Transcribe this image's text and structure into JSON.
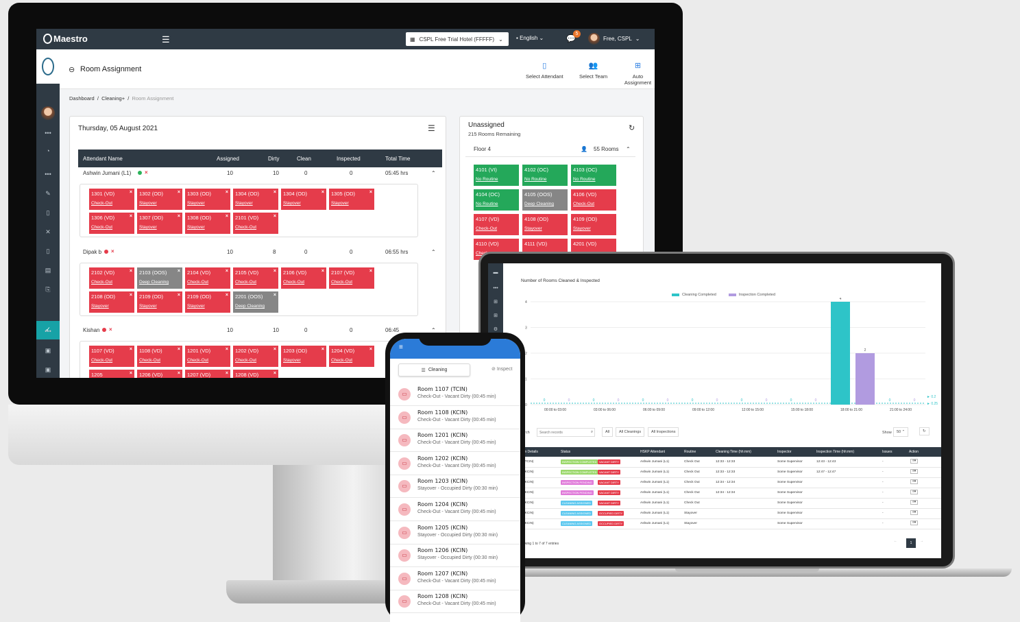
{
  "app": {
    "logo": "Maestro",
    "hotel": "CSPL Free Trial Hotel (FFFFF)",
    "language": "English",
    "notifications": "5",
    "user": "Free, CSPL",
    "page_title": "Room Assignment",
    "actions": [
      "Select Attendant",
      "Select Team",
      "Auto Assignment"
    ],
    "breadcrumb": [
      "Dashboard",
      "Cleaning+",
      "Room Assignment"
    ],
    "date": "Thursday, 05 August 2021"
  },
  "table": {
    "headers": [
      "Attendant Name",
      "Assigned",
      "Dirty",
      "Clean",
      "Inspected",
      "Total Time"
    ],
    "attendants": [
      {
        "name": "Ashwin Jumani (L1)",
        "status": "#2bb25a",
        "assigned": "10",
        "dirty": "10",
        "clean": "0",
        "inspected": "0",
        "time": "05:45 hrs",
        "rooms": [
          {
            "room": "1301 (VD)",
            "type": "Check-Out",
            "color": "red"
          },
          {
            "room": "1302 (OD)",
            "type": "Stayover",
            "color": "red"
          },
          {
            "room": "1303 (OD)",
            "type": "Stayover",
            "color": "red"
          },
          {
            "room": "1304 (OD)",
            "type": "Stayover",
            "color": "red"
          },
          {
            "room": "1304 (OD)",
            "type": "Stayover",
            "color": "red"
          },
          {
            "room": "1305 (OD)",
            "type": "Stayover",
            "color": "red"
          },
          {
            "room": "1306 (VD)",
            "type": "Check-Out",
            "color": "red"
          },
          {
            "room": "1307 (OD)",
            "type": "Stayover",
            "color": "red"
          },
          {
            "room": "1308 (OD)",
            "type": "Stayover",
            "color": "red"
          },
          {
            "room": "2101 (VD)",
            "type": "Check-Out",
            "color": "red"
          }
        ]
      },
      {
        "name": "Dipak b",
        "status": "#e53c4b",
        "assigned": "10",
        "dirty": "8",
        "clean": "0",
        "inspected": "0",
        "time": "06:55 hrs",
        "rooms": [
          {
            "room": "2102 (VD)",
            "type": "Check-Out",
            "color": "red"
          },
          {
            "room": "2103 (OOS)",
            "type": "Deep Cleaning",
            "color": "grey"
          },
          {
            "room": "2104 (VD)",
            "type": "Check-Out",
            "color": "red"
          },
          {
            "room": "2105 (VD)",
            "type": "Check-Out",
            "color": "red"
          },
          {
            "room": "2106 (VD)",
            "type": "Check-Out",
            "color": "red"
          },
          {
            "room": "2107 (VD)",
            "type": "Check-Out",
            "color": "red"
          },
          {
            "room": "2108 (OD)",
            "type": "Stayover",
            "color": "red"
          },
          {
            "room": "2109 (OD)",
            "type": "Stayover",
            "color": "red"
          },
          {
            "room": "2109 (OD)",
            "type": "Stayover",
            "color": "red"
          },
          {
            "room": "2201 (OOS)",
            "type": "Deep Cleaning",
            "color": "grey"
          }
        ]
      },
      {
        "name": "Kishan",
        "status": "#e53c4b",
        "assigned": "10",
        "dirty": "10",
        "clean": "0",
        "inspected": "0",
        "time": "06:45",
        "rooms": [
          {
            "room": "1107 (VD)",
            "type": "Check-Out",
            "color": "red"
          },
          {
            "room": "1108 (VD)",
            "type": "Check-Out",
            "color": "red"
          },
          {
            "room": "1201 (VD)",
            "type": "Check-Out",
            "color": "red"
          },
          {
            "room": "1202 (VD)",
            "type": "Check-Out",
            "color": "red"
          },
          {
            "room": "1203 (OD)",
            "type": "Stayover",
            "color": "red"
          },
          {
            "room": "1204 (VD)",
            "type": "Check-Out",
            "color": "red"
          },
          {
            "room": "1205",
            "type": "Stay",
            "color": "red"
          },
          {
            "room": "1206 (VD)",
            "type": "",
            "color": "red"
          },
          {
            "room": "1207 (VD)",
            "type": "",
            "color": "red"
          },
          {
            "room": "1208 (VD)",
            "type": "",
            "color": "red"
          }
        ]
      }
    ]
  },
  "unassigned": {
    "title": "Unassigned",
    "remaining": "215 Rooms Remaining",
    "floor": "Floor 4",
    "floor_rooms": "55 Rooms",
    "rooms": [
      {
        "room": "4101 (VI)",
        "type": "No Routine",
        "color": "green"
      },
      {
        "room": "4102 (OC)",
        "type": "No Routine",
        "color": "green"
      },
      {
        "room": "4103 (OC)",
        "type": "No Routine",
        "color": "green"
      },
      {
        "room": "4104 (OC)",
        "type": "No Routine",
        "color": "green"
      },
      {
        "room": "4105 (OOS)",
        "type": "Deep Cleaning",
        "color": "grey"
      },
      {
        "room": "4106 (VD)",
        "type": "Check-Out",
        "color": "red"
      },
      {
        "room": "4107 (VD)",
        "type": "Check-Out",
        "color": "red"
      },
      {
        "room": "4108 (OD)",
        "type": "Stayover",
        "color": "red"
      },
      {
        "room": "4109 (OD)",
        "type": "Stayover",
        "color": "red"
      },
      {
        "room": "4110 (VD)",
        "type": "Check",
        "color": "red"
      },
      {
        "room": "4111 (VD)",
        "type": "",
        "color": "red"
      },
      {
        "room": "4201 (VD)",
        "type": "",
        "color": "red"
      }
    ]
  },
  "chart_data": {
    "type": "bar",
    "title": "Number of Rooms Cleaned & Inspected",
    "categories": [
      "00:00 to 03:00",
      "03:00 to 06:00",
      "06:00 to 09:00",
      "09:00 to 12:00",
      "12:00 to 15:00",
      "15:00 to 18:00",
      "18:00 to 21:00",
      "21:00 to 24:00"
    ],
    "series": [
      {
        "name": "Cleaning Completed",
        "color": "#2ec4c8",
        "values": [
          0,
          0,
          0,
          0,
          0,
          0,
          4,
          0
        ]
      },
      {
        "name": "Inspection Completed",
        "color": "#b19be0",
        "values": [
          0,
          0,
          0,
          0,
          0,
          0,
          2,
          0
        ]
      }
    ],
    "ylim": [
      0,
      4
    ],
    "yticks": [
      "0",
      "1",
      "2",
      "3",
      "4"
    ],
    "reference_labels": [
      "0.2",
      "0.25"
    ]
  },
  "report": {
    "search_label": "rch",
    "search_placeholder": "Search records",
    "filters": [
      "All",
      "All Cleanings",
      "All Inspections"
    ],
    "show_label": "Show",
    "show_value": "50",
    "headers": [
      "m Details",
      "Status",
      "HSKP Attendant",
      "Routine",
      "Cleaning Time (hh:mm)",
      "Inspector",
      "Inspection Time (hh:mm)",
      "Issues",
      "Action"
    ],
    "rows": [
      {
        "room": "(TCIN)",
        "s1": "INSPECTION COMPLETED",
        "c1": "#9bd86b",
        "s2": "VACANT DIRTY",
        "c2": "#e53c4b",
        "att": "Ashwin Jumani (L1)",
        "routine": "Check Out",
        "ctime": "12:33 - 12:33",
        "insp": "Some Supervisor",
        "itime": "12:43 - 12:43",
        "issues": "-"
      },
      {
        "room": "(KCIN)",
        "s1": "INSPECTION COMPLETED",
        "c1": "#9bd86b",
        "s2": "VACANT DIRTY",
        "c2": "#e53c4b",
        "att": "Ashwin Jumani (L1)",
        "routine": "Check Out",
        "ctime": "12:33 - 12:33",
        "insp": "Some Supervisor",
        "itime": "12:47 - 12:47",
        "issues": "-"
      },
      {
        "room": "(KCIN)",
        "s1": "INSPECTION PENDING",
        "c1": "#e07ad9",
        "s2": "VACANT DIRTY",
        "c2": "#e53c4b",
        "att": "Ashwin Jumani (L1)",
        "routine": "Check Out",
        "ctime": "12:34 - 12:34",
        "insp": "Some Supervisor",
        "itime": "",
        "issues": "-"
      },
      {
        "room": "(KCIN)",
        "s1": "INSPECTION PENDING",
        "c1": "#e07ad9",
        "s2": "VACANT DIRTY",
        "c2": "#e53c4b",
        "att": "Ashwin Jumani (L1)",
        "routine": "Check Out",
        "ctime": "12:34 - 12:34",
        "insp": "Some Supervisor",
        "itime": "",
        "issues": "-"
      },
      {
        "room": "(KCIN)",
        "s1": "CLEANING ASSIGNED",
        "c1": "#5ec8ef",
        "s2": "VACANT DIRTY",
        "c2": "#e53c4b",
        "att": "Ashwin Jumani (L1)",
        "routine": "Check Out",
        "ctime": "",
        "insp": "Some Supervisor",
        "itime": "",
        "issues": "-"
      },
      {
        "room": "(KCIN)",
        "s1": "CLEANING ASSIGNED",
        "c1": "#5ec8ef",
        "s2": "OCCUPIED DIRTY",
        "c2": "#e53c4b",
        "att": "Ashwin Jumani (L1)",
        "routine": "Stayover",
        "ctime": "",
        "insp": "Some Supervisor",
        "itime": "",
        "issues": "-"
      },
      {
        "room": "(KCIN)",
        "s1": "CLEANING ASSIGNED",
        "c1": "#5ec8ef",
        "s2": "OCCUPIED DIRTY",
        "c2": "#e53c4b",
        "att": "Ashwin Jumani (L1)",
        "routine": "Stayover",
        "ctime": "",
        "insp": "Some Supervisor",
        "itime": "",
        "issues": "-"
      }
    ],
    "footer": "owing 1 to 7 of 7 entries",
    "page": "1"
  },
  "mobile": {
    "tabs": [
      "Cleaning",
      "Inspect"
    ],
    "items": [
      {
        "name": "Room 1107 (TCIN)",
        "detail": "Check-Out - Vacant Dirty (00:45 min)"
      },
      {
        "name": "Room 1108 (KCIN)",
        "detail": "Check-Out - Vacant Dirty (00:45 min)"
      },
      {
        "name": "Room 1201 (KCIN)",
        "detail": "Check-Out - Vacant Dirty (00:45 min)"
      },
      {
        "name": "Room 1202 (KCIN)",
        "detail": "Check-Out - Vacant Dirty (00:45 min)"
      },
      {
        "name": "Room 1203 (KCIN)",
        "detail": "Stayover - Occupied Dirty (00:30 min)"
      },
      {
        "name": "Room 1204 (KCIN)",
        "detail": "Check-Out - Vacant Dirty (00:45 min)"
      },
      {
        "name": "Room 1205 (KCIN)",
        "detail": "Stayover - Occupied Dirty (00:30 min)"
      },
      {
        "name": "Room 1206 (KCIN)",
        "detail": "Stayover - Occupied Dirty (00:30 min)"
      },
      {
        "name": "Room 1207 (KCIN)",
        "detail": "Check-Out - Vacant Dirty (00:45 min)"
      },
      {
        "name": "Room 1208 (KCIN)",
        "detail": "Check-Out - Vacant Dirty (00:45 min)"
      }
    ]
  }
}
